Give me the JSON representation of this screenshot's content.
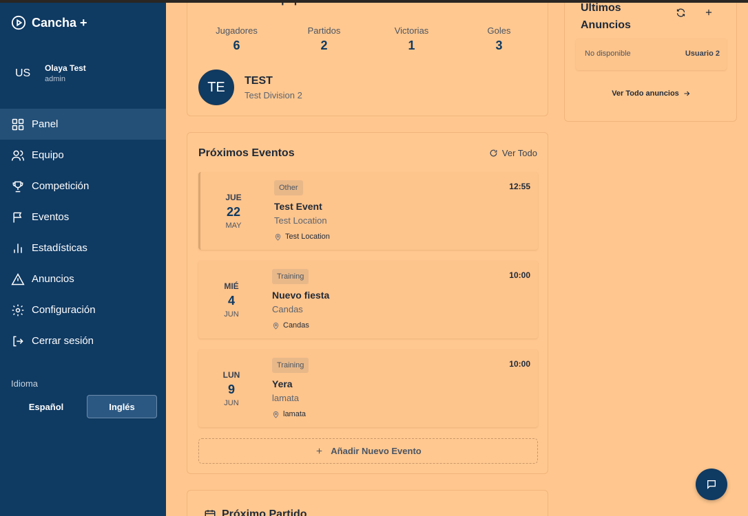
{
  "brand": {
    "name": "Cancha +",
    "icon": "play-circle-icon"
  },
  "user": {
    "initials": "US",
    "name": "Olaya Test",
    "role": "admin"
  },
  "nav": [
    {
      "label": "Panel",
      "icon": "grid-icon",
      "active": true
    },
    {
      "label": "Equipo",
      "icon": "users-icon"
    },
    {
      "label": "Competición",
      "icon": "trophy-icon"
    },
    {
      "label": "Eventos",
      "icon": "flag-icon"
    },
    {
      "label": "Estadísticas",
      "icon": "bar-chart-icon"
    },
    {
      "label": "Anuncios",
      "icon": "alert-triangle-icon"
    },
    {
      "label": "Configuración",
      "icon": "gear-icon"
    },
    {
      "label": "Cerrar sesión",
      "icon": "logout-icon"
    }
  ],
  "language": {
    "title": "Idioma",
    "options": [
      "Español",
      "Inglés"
    ],
    "selected": "Inglés"
  },
  "summary": {
    "title": "Resumen del Equipo",
    "stats": [
      {
        "label": "Jugadores",
        "value": "6"
      },
      {
        "label": "Partidos",
        "value": "2"
      },
      {
        "label": "Victorias",
        "value": "1"
      },
      {
        "label": "Goles",
        "value": "3"
      }
    ],
    "team": {
      "initials": "TE",
      "name": "TEST",
      "division": "Test Division 2"
    }
  },
  "events": {
    "title": "Próximos Eventos",
    "view_all": "Ver Todo",
    "items": [
      {
        "dow": "JUE",
        "day": "22",
        "month": "MAY",
        "type": "Other",
        "title": "Test Event",
        "location": "Test Location",
        "place": "Test Location",
        "time": "12:55"
      },
      {
        "dow": "MIÉ",
        "day": "4",
        "month": "JUN",
        "type": "Training",
        "title": "Nuevo fiesta",
        "location": "Candas",
        "place": "Candas",
        "time": "10:00"
      },
      {
        "dow": "LUN",
        "day": "9",
        "month": "JUN",
        "type": "Training",
        "title": "Yera",
        "location": "lamata",
        "place": "lamata",
        "time": "10:00"
      }
    ],
    "add_label": "Añadir Nuevo Evento"
  },
  "next_match": {
    "title": "Próximo Partido"
  },
  "announcements": {
    "title": "Últimos Anuncios",
    "item": {
      "status": "No disponible",
      "author": "Usuario 2"
    },
    "view_all": "Ver Todo anuncios"
  },
  "colors": {
    "sidebar": "#0f3a62",
    "background": "#ffc78f",
    "accent": "#0f3a62"
  }
}
